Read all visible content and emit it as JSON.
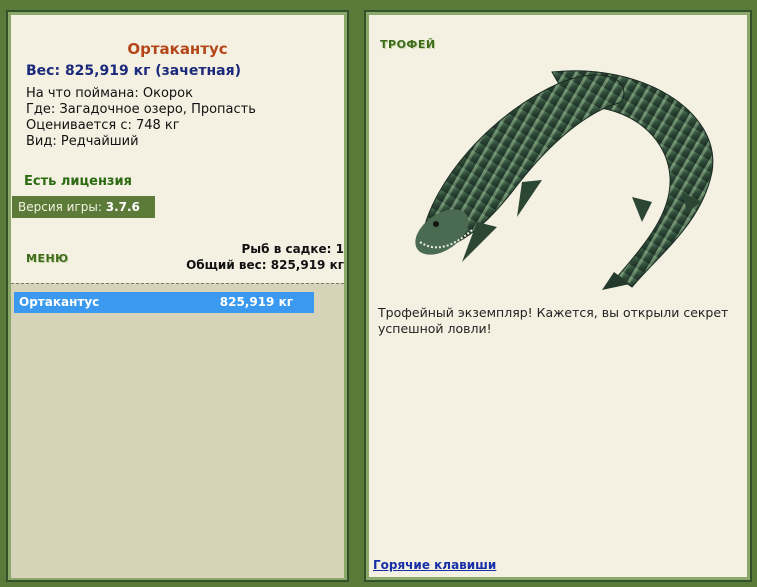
{
  "fish": {
    "name": "Ортакантус",
    "weight_line": "Вес: 825,919 кг (зачетная)",
    "bait": "На что поймана: Окорок",
    "location": "Где: Загадочное озеро, Пропасть",
    "valued": "Оценивается с: 748 кг",
    "rarity": "Вид: Редчайший"
  },
  "license": "Есть лицензия",
  "version": {
    "label": "Версия игры:",
    "value": "3.7.6"
  },
  "menu_label": "МЕНЮ",
  "stats": {
    "count": "Рыб в садке: 1",
    "total_weight": "Общий вес: 825,919 кг"
  },
  "cage": [
    {
      "name": "Ортакантус",
      "weight": "825,919 кг"
    }
  ],
  "trophy_label": "ТРОФЕЙ",
  "trophy_message": "Трофейный экземпляр! Кажется, вы открыли секрет успешной ловли!",
  "hotkeys_link": "Горячие клавиши",
  "colors": {
    "background": "#5a7a3a",
    "panel": "#f4f1e2",
    "selected_row": "#3b9af0",
    "name": "#b5461a"
  }
}
